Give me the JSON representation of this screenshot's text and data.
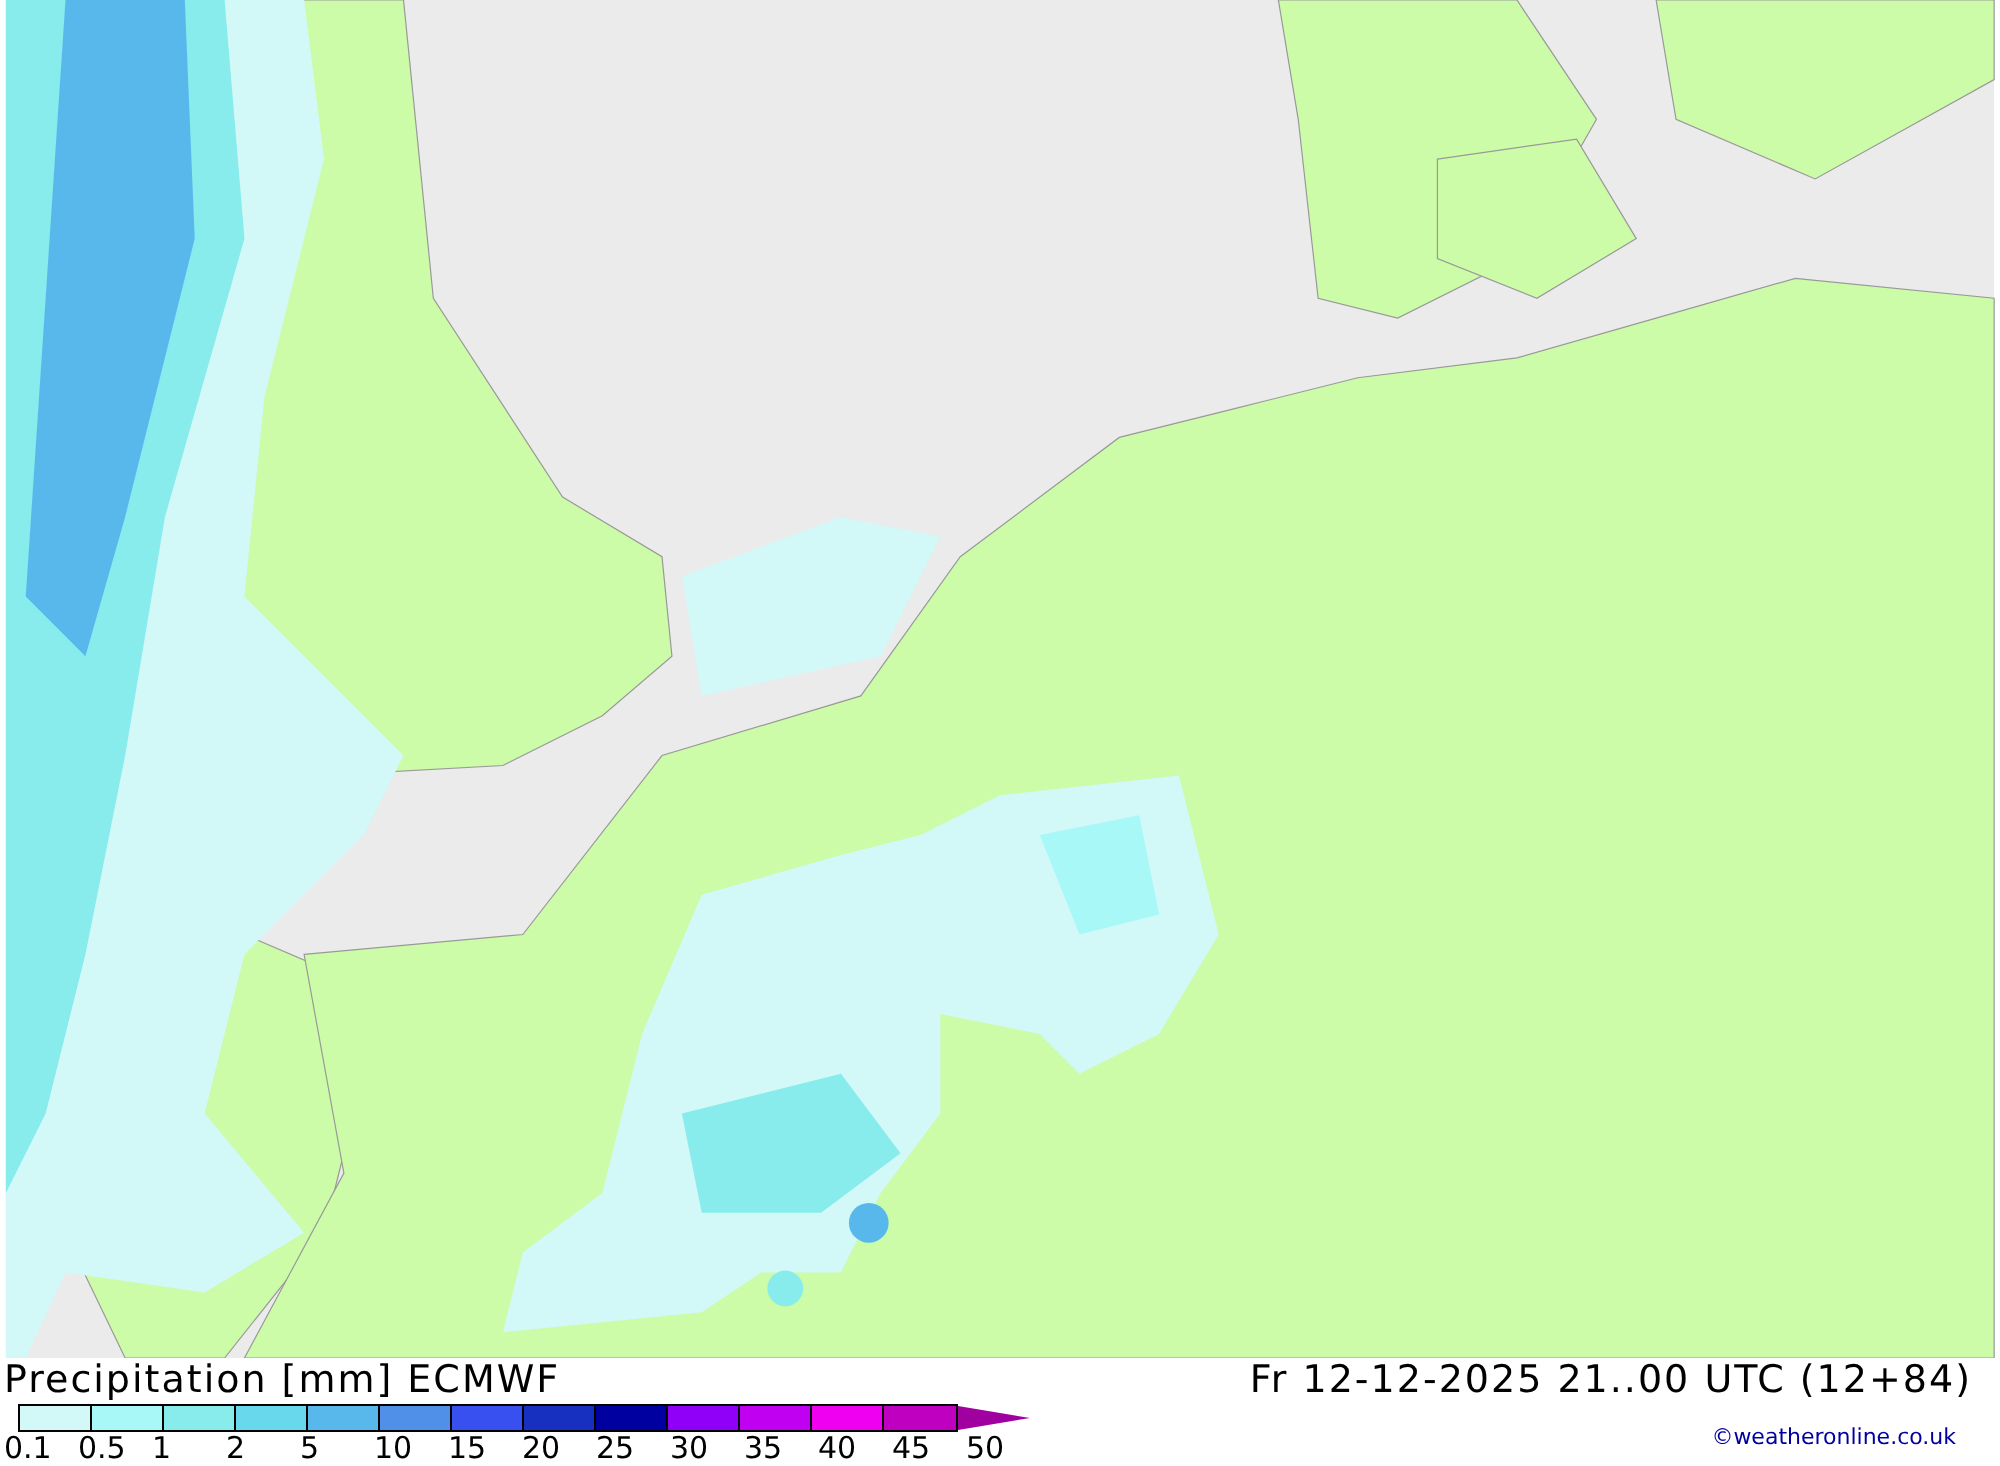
{
  "title": "Precipitation [mm] ECMWF",
  "valid_time": "Fr 12-12-2025 21..00 UTC (12+84)",
  "legend": {
    "bins": [
      {
        "color": "#d2f8f8"
      },
      {
        "color": "#a8f8f8"
      },
      {
        "color": "#88ecec"
      },
      {
        "color": "#68d8ec"
      },
      {
        "color": "#58b8ec"
      },
      {
        "color": "#5090e8"
      },
      {
        "color": "#3850f0"
      },
      {
        "color": "#1830c0"
      },
      {
        "color": "#0000a0"
      },
      {
        "color": "#9000f8"
      },
      {
        "color": "#c000f0"
      },
      {
        "color": "#f000f0"
      },
      {
        "color": "#c000c0"
      }
    ],
    "overflow": [
      {
        "kind": "arrow",
        "color": "#a000a0"
      }
    ],
    "ticks": [
      "0.1",
      "0.5",
      "1",
      "2",
      "5",
      "10",
      "15",
      "20",
      "25",
      "30",
      "35",
      "40",
      "45",
      "50"
    ]
  },
  "credit": "©weatheronline.co.uk"
}
